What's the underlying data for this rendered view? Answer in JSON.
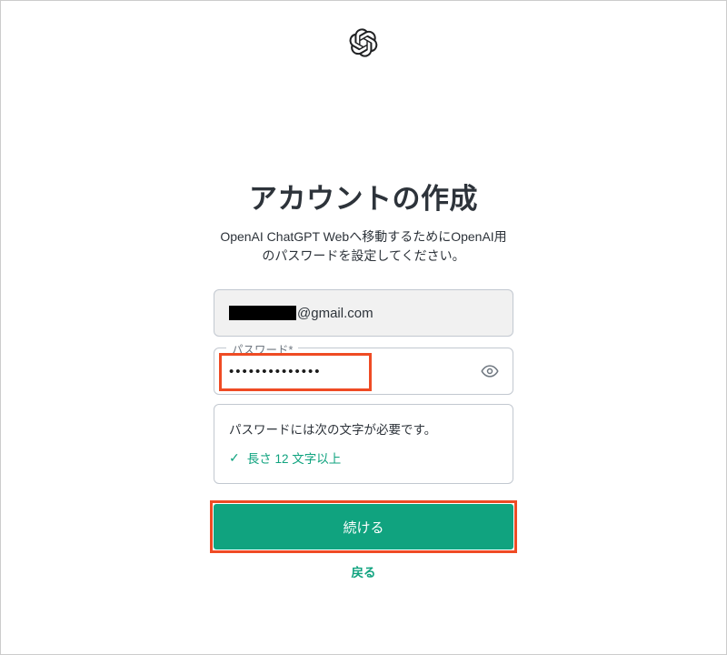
{
  "header": {
    "logo_name": "openai-logo"
  },
  "title": "アカウントの作成",
  "subtitle": "OpenAI ChatGPT Webへ移動するためにOpenAI用のパスワードを設定してください。",
  "email": {
    "domain_part": "@gmail.com"
  },
  "password": {
    "label": "パスワード*",
    "masked_value": "••••••••••••••",
    "toggle_icon": "eye-icon"
  },
  "rules": {
    "heading": "パスワードには次の文字が必要です。",
    "items": [
      {
        "met": true,
        "text": "長さ 12 文字以上"
      }
    ]
  },
  "actions": {
    "continue_label": "続ける",
    "back_label": "戻る"
  },
  "colors": {
    "accent": "#10a37f",
    "highlight": "#ef4b24"
  }
}
